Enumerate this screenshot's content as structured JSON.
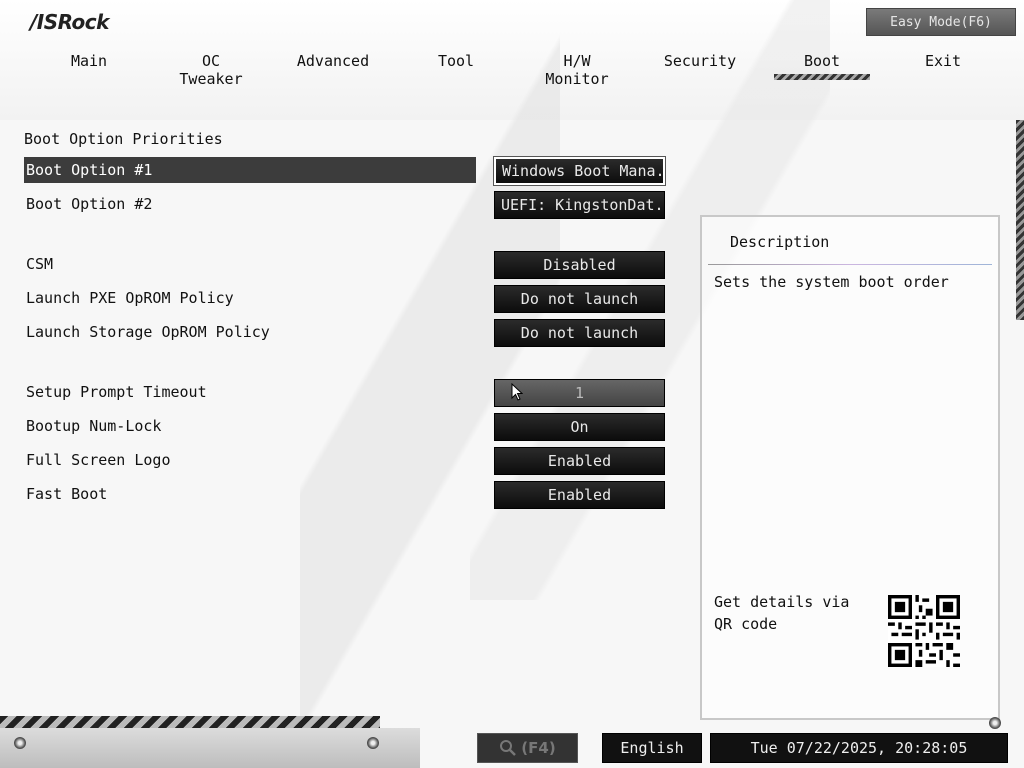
{
  "brand": {
    "logo": "/ISRock"
  },
  "header": {
    "easy_mode_label": "Easy Mode(F6)"
  },
  "tabs": [
    {
      "label": "Main"
    },
    {
      "label": "OC Tweaker"
    },
    {
      "label": "Advanced"
    },
    {
      "label": "Tool"
    },
    {
      "label": "H/W Monitor"
    },
    {
      "label": "Security"
    },
    {
      "label": "Boot"
    },
    {
      "label": "Exit"
    }
  ],
  "active_tab": "Boot",
  "section_title": "Boot Option Priorities",
  "settings": [
    {
      "label": "Boot Option #1",
      "value": "Windows Boot Mana..."
    },
    {
      "label": "Boot Option #2",
      "value": "UEFI: KingstonDat..."
    },
    {
      "label": "CSM",
      "value": "Disabled"
    },
    {
      "label": "Launch PXE OpROM Policy",
      "value": "Do not launch"
    },
    {
      "label": "Launch Storage OpROM Policy",
      "value": "Do not launch"
    },
    {
      "label": "Setup Prompt Timeout",
      "value": "1"
    },
    {
      "label": "Bootup Num-Lock",
      "value": "On"
    },
    {
      "label": "Full Screen Logo",
      "value": "Enabled"
    },
    {
      "label": "Fast Boot",
      "value": "Enabled"
    }
  ],
  "description": {
    "title": "Description",
    "text": "Sets the system boot order",
    "qr_text": "Get details via QR code"
  },
  "footer": {
    "search_label": "(F4)",
    "language": "English",
    "datetime": "Tue 07/22/2025, 20:28:05"
  },
  "colors": {
    "selected_row": "#3c3c3c",
    "value_box": "#111111",
    "background": "#f7f7f7"
  }
}
